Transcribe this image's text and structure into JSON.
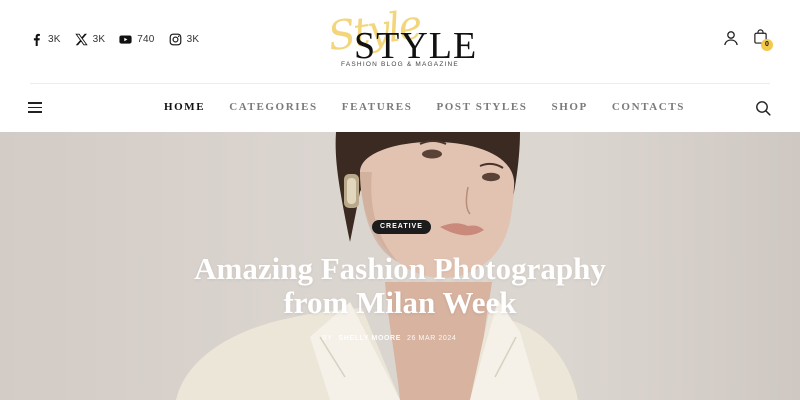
{
  "socials": [
    {
      "icon": "facebook-icon",
      "count": "3K"
    },
    {
      "icon": "x-icon",
      "count": "3K"
    },
    {
      "icon": "youtube-icon",
      "count": "740"
    },
    {
      "icon": "instagram-icon",
      "count": "3K"
    }
  ],
  "logo": {
    "script": "Style",
    "word": "STYLE",
    "tagline": "FASHION BLOG & MAGAZINE",
    "accent_color": "#f0c850"
  },
  "header": {
    "cart_count": "0",
    "badge_color": "#f2c94c"
  },
  "nav": {
    "items": [
      "HOME",
      "CATEGORIES",
      "FEATURES",
      "POST STYLES",
      "SHOP",
      "CONTACTS"
    ],
    "active": "HOME"
  },
  "hero": {
    "category": "CREATIVE",
    "title_line1": "Amazing Fashion Photography",
    "title_line2": "from Milan Week",
    "author_prefix": "BY",
    "author": "SHELLY MOORE",
    "date": "26 MAR 2024"
  }
}
